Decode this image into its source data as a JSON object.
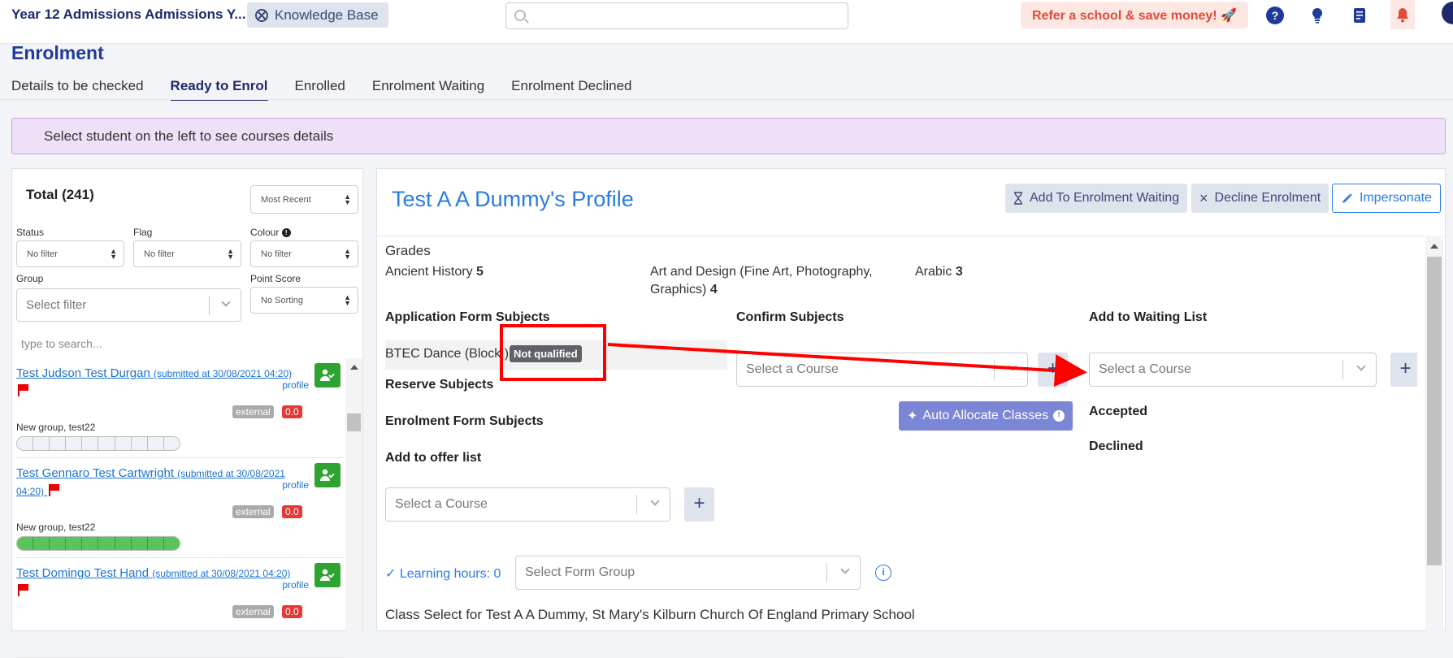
{
  "header": {
    "app_title": "Year 12 Admissions Admissions Y...",
    "kb_label": "Knowledge Base",
    "refer_label": "Refer a school & save money! 🚀",
    "search_placeholder": ""
  },
  "page": {
    "title": "Enrolment",
    "tabs": [
      {
        "label": "Details to be checked",
        "active": false
      },
      {
        "label": "Ready to Enrol",
        "active": true
      },
      {
        "label": "Enrolled",
        "active": false
      },
      {
        "label": "Enrolment Waiting",
        "active": false
      },
      {
        "label": "Enrolment Declined",
        "active": false
      }
    ],
    "banner": "Select student on the left to see courses details"
  },
  "left": {
    "total": "Total (241)",
    "sort": "Most Recent",
    "filters": {
      "status_label": "Status",
      "status_value": "No filter",
      "flag_label": "Flag",
      "flag_value": "No filter",
      "colour_label": "Colour",
      "colour_value": "No filter",
      "group_label": "Group",
      "group_placeholder": "Select filter",
      "point_label": "Point Score",
      "point_value": "No Sorting"
    },
    "search_placeholder": "type to search...",
    "students": [
      {
        "name": "Test Judson Test Durgan",
        "submitted": "(submitted at 30/08/2021 04:20)",
        "profile": "profile",
        "external": "external",
        "score": "0.0",
        "group": "New group, test22",
        "progress_filled": 0,
        "progress_total": 10
      },
      {
        "name": "Test Gennaro Test Cartwright",
        "submitted_a": "(submitted at 30/08/2021",
        "submitted_b": "04:20)",
        "profile": "profile",
        "external": "external",
        "score": "0.0",
        "group": "New group, test22",
        "progress_filled": 10,
        "progress_total": 10
      },
      {
        "name": "Test Domingo Test Hand",
        "submitted": "(submitted at 30/08/2021 04:20)",
        "profile": "profile",
        "external": "external",
        "score": "0.0"
      }
    ]
  },
  "profile": {
    "title": "Test A A Dummy's Profile",
    "btn_wait": "Add To Enrolment Waiting",
    "btn_decline": "Decline Enrolment",
    "btn_impersonate": "Impersonate",
    "grades_heading": "Grades",
    "grades": [
      {
        "subject": "Ancient History",
        "grade": "5"
      },
      {
        "subject_a": "Art and Design (Fine Art, Photography,",
        "subject_b": "Graphics)",
        "grade": "4"
      },
      {
        "subject": "Arabic",
        "grade": "3"
      }
    ],
    "app_form_subjects": "Application Form Subjects",
    "btec_text": "BTEC Dance (Block )",
    "not_qualified": "Not qualified",
    "reserve_subjects": "Reserve Subjects",
    "enrolment_form_subjects": "Enrolment Form Subjects",
    "add_offer_list": "Add to offer list",
    "confirm_subjects": "Confirm Subjects",
    "add_waiting_list": "Add to Waiting List",
    "select_course": "Select a Course",
    "auto_allocate": "Auto Allocate Classes",
    "accepted": "Accepted",
    "declined": "Declined",
    "learning_hours": "Learning hours: 0",
    "select_form_group": "Select Form Group",
    "class_select": "Class Select for Test A A Dummy, St Mary's Kilburn Church Of England Primary School"
  },
  "colors": {
    "accent": "#2a7be4",
    "navy": "#1f2a6b",
    "annotation": "#ff0000"
  }
}
